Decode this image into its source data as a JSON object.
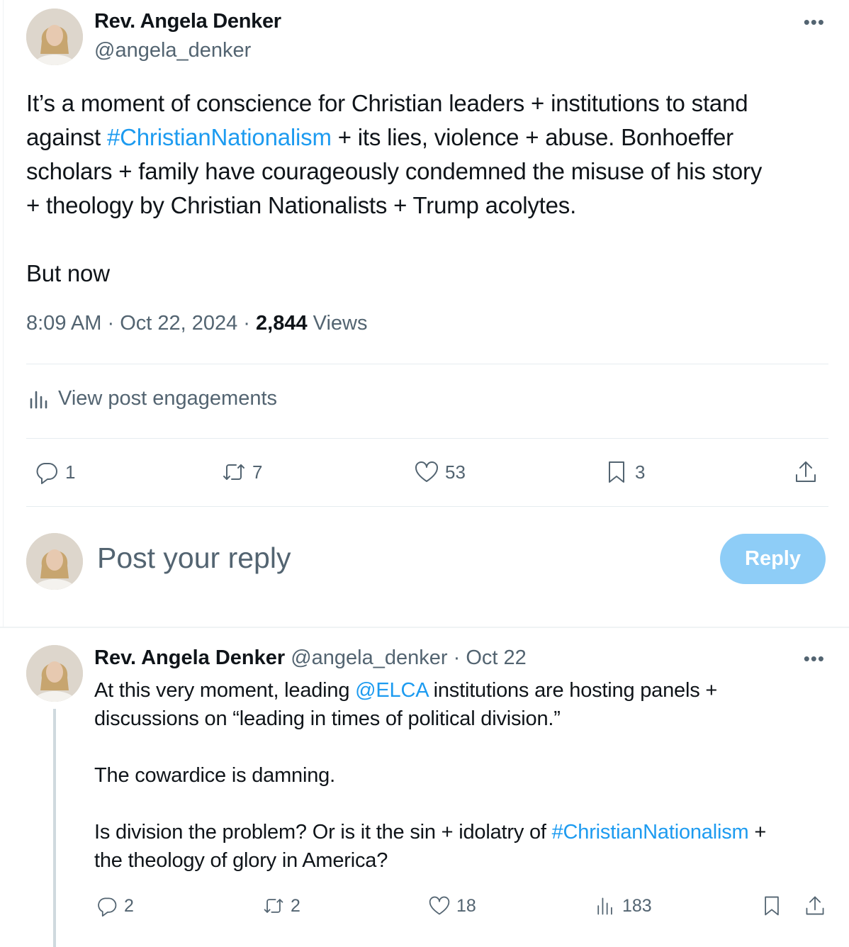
{
  "post": {
    "author_name": "Rev. Angela Denker",
    "author_handle": "@angela_denker",
    "more_label": "•••",
    "text_lines": [
      [
        "It’s a moment of conscience for Christian leaders + institutions to stand"
      ],
      [
        "against ",
        "#ChristianNationalism",
        " + its lies, violence + abuse. Bonhoeffer"
      ],
      [
        "scholars + family have courageously condemned the misuse of his story"
      ],
      [
        "+ theology by Christian Nationalists + Trump acolytes."
      ],
      [
        "But now"
      ]
    ],
    "time": "8:09 AM",
    "date": "Oct 22, 2024",
    "views_count": "2,844",
    "views_label": "Views",
    "view_engagements": "View post engagements",
    "stats": {
      "replies": "1",
      "reposts": "7",
      "likes": "53",
      "bookmarks": "3"
    }
  },
  "reply_box": {
    "placeholder": "Post your reply",
    "button": "Reply"
  },
  "thread_reply": {
    "author_name": "Rev. Angela Denker",
    "author_handle": "@angela_denker",
    "date": "Oct 22",
    "more_label": "•••",
    "text_lines": [
      [
        "At this very moment, leading ",
        "@ELCA",
        " institutions are hosting panels +"
      ],
      [
        "discussions on “leading in times of political division.”"
      ],
      [
        "The cowardice is damning."
      ],
      [
        "Is division the problem? Or is it the sin + idolatry of ",
        "#ChristianNationalism",
        " +"
      ],
      [
        "the theology of glory in America?"
      ]
    ],
    "stats": {
      "replies": "2",
      "reposts": "2",
      "likes": "18",
      "views": "183"
    }
  },
  "colors": {
    "link": "#1d9bf0",
    "muted": "#536471",
    "reply_button": "#8ecdf7"
  }
}
